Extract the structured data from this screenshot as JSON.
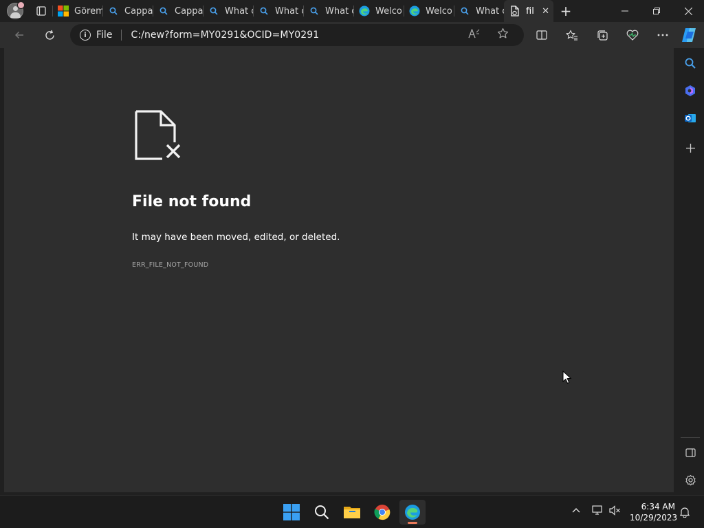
{
  "browser": {
    "tabs": [
      {
        "label": "Görem",
        "favicon": "microsoft-logo-icon"
      },
      {
        "label": "Cappa",
        "favicon": "search-icon"
      },
      {
        "label": "Cappa",
        "favicon": "search-icon"
      },
      {
        "label": "What c",
        "favicon": "search-icon"
      },
      {
        "label": "What c",
        "favicon": "search-icon"
      },
      {
        "label": "What c",
        "favicon": "search-icon"
      },
      {
        "label": "Welco",
        "favicon": "edge-icon"
      },
      {
        "label": "Welco",
        "favicon": "edge-icon"
      },
      {
        "label": "What c",
        "favicon": "search-icon"
      },
      {
        "label": "fil",
        "favicon": "file-error-icon",
        "active": true
      }
    ],
    "address": {
      "scheme_label": "File",
      "url": "C:/new?form=MY0291&OCID=MY0291"
    },
    "read_aloud_label": "A̅"
  },
  "page": {
    "title": "File not found",
    "description": "It may have been moved, edited, or deleted.",
    "error_code": "ERR_FILE_NOT_FOUND"
  },
  "taskbar": {
    "time": "6:34 AM",
    "date": "10/29/2023"
  },
  "colors": {
    "page_bg": "#2e2e2e",
    "chrome_bg": "#202020",
    "accent": "#0078d4"
  }
}
